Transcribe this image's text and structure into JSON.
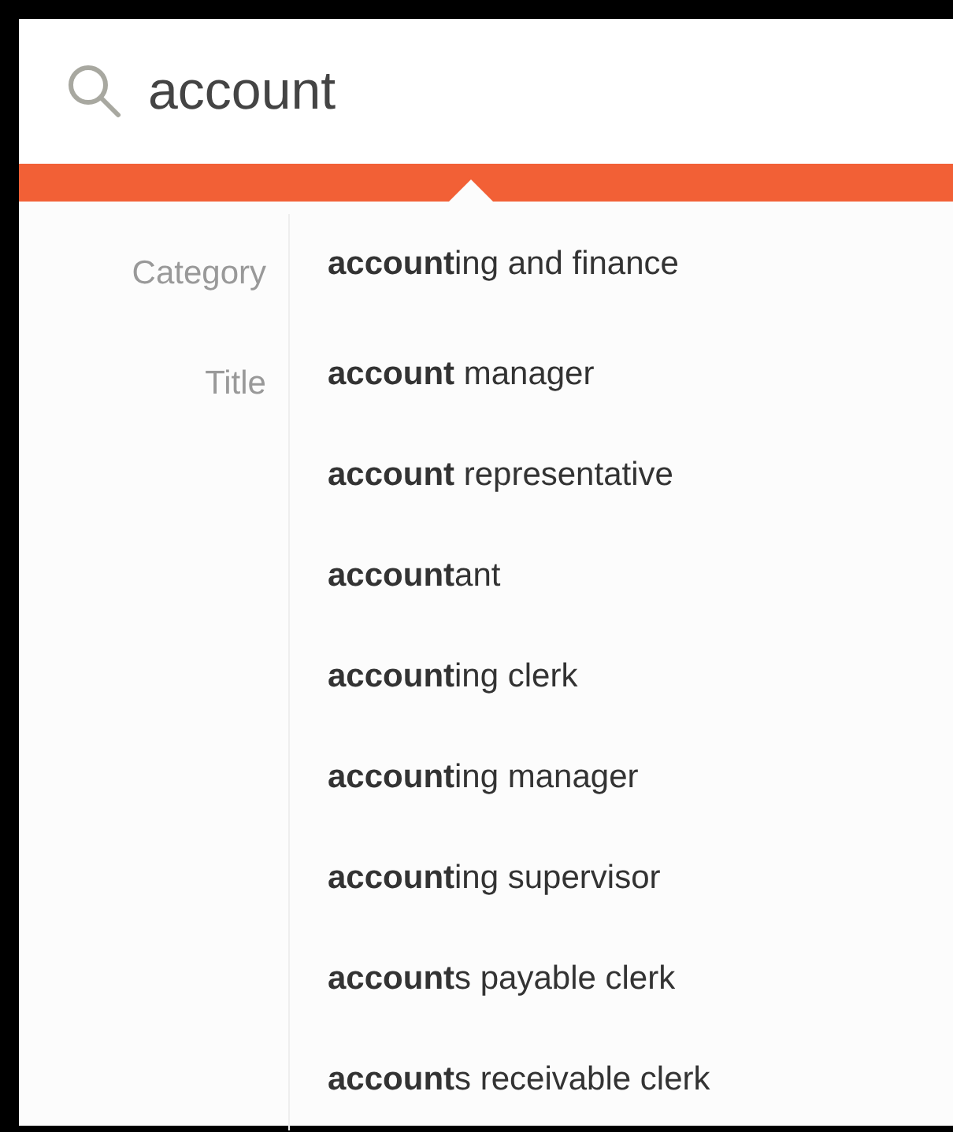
{
  "search": {
    "value": "account"
  },
  "groups": [
    {
      "label": "Category",
      "items": [
        "**account**ing and finance"
      ]
    },
    {
      "label": "Title",
      "items": [
        "**account** manager",
        "**account** representative",
        "**account**ant",
        "**account**ing clerk",
        "**account**ing manager",
        "**account**ing supervisor",
        "**account**s payable clerk",
        "**account**s receivable clerk"
      ]
    }
  ]
}
